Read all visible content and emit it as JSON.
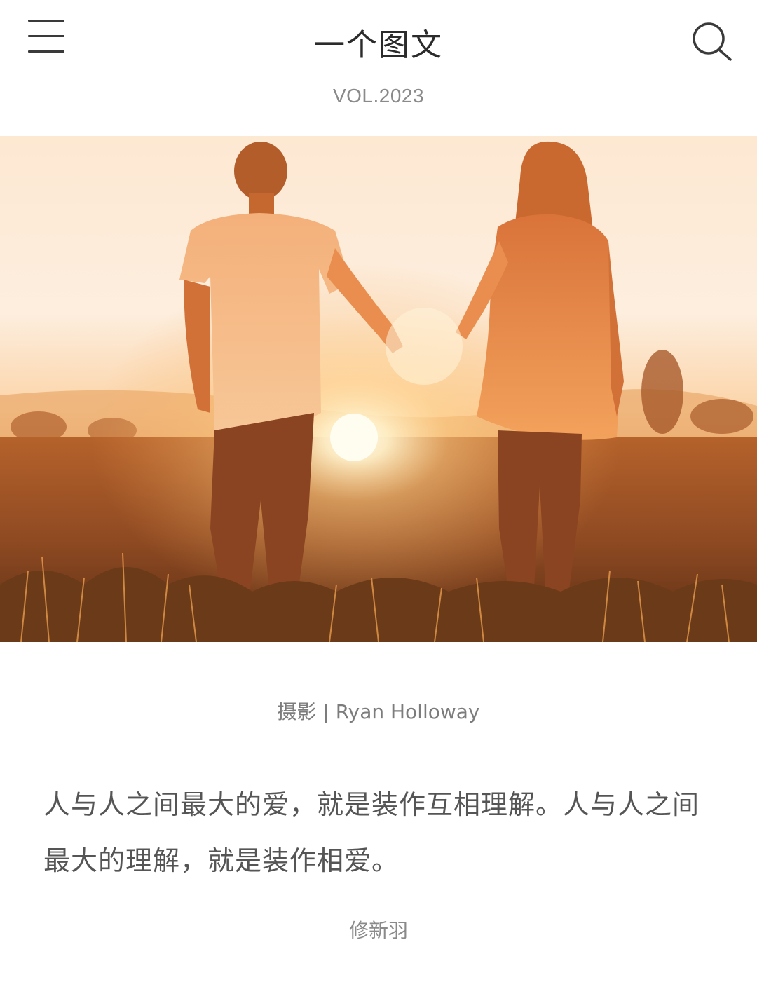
{
  "header": {
    "title": "一个图文",
    "menu_icon": "menu-icon",
    "search_icon": "search-icon"
  },
  "issue": {
    "volume": "VOL.2023"
  },
  "photo": {
    "credit": "摄影 | Ryan Holloway"
  },
  "article": {
    "quote": "人与人之间最大的爱，就是装作互相理解。人与人之间最大的理解，就是装作相爱。",
    "author": "修新羽"
  },
  "colors": {
    "title": "#2b2b2b",
    "secondary_text": "#8a8a8a",
    "body_text": "#555555",
    "sunset_orange": "#f5a04a"
  }
}
